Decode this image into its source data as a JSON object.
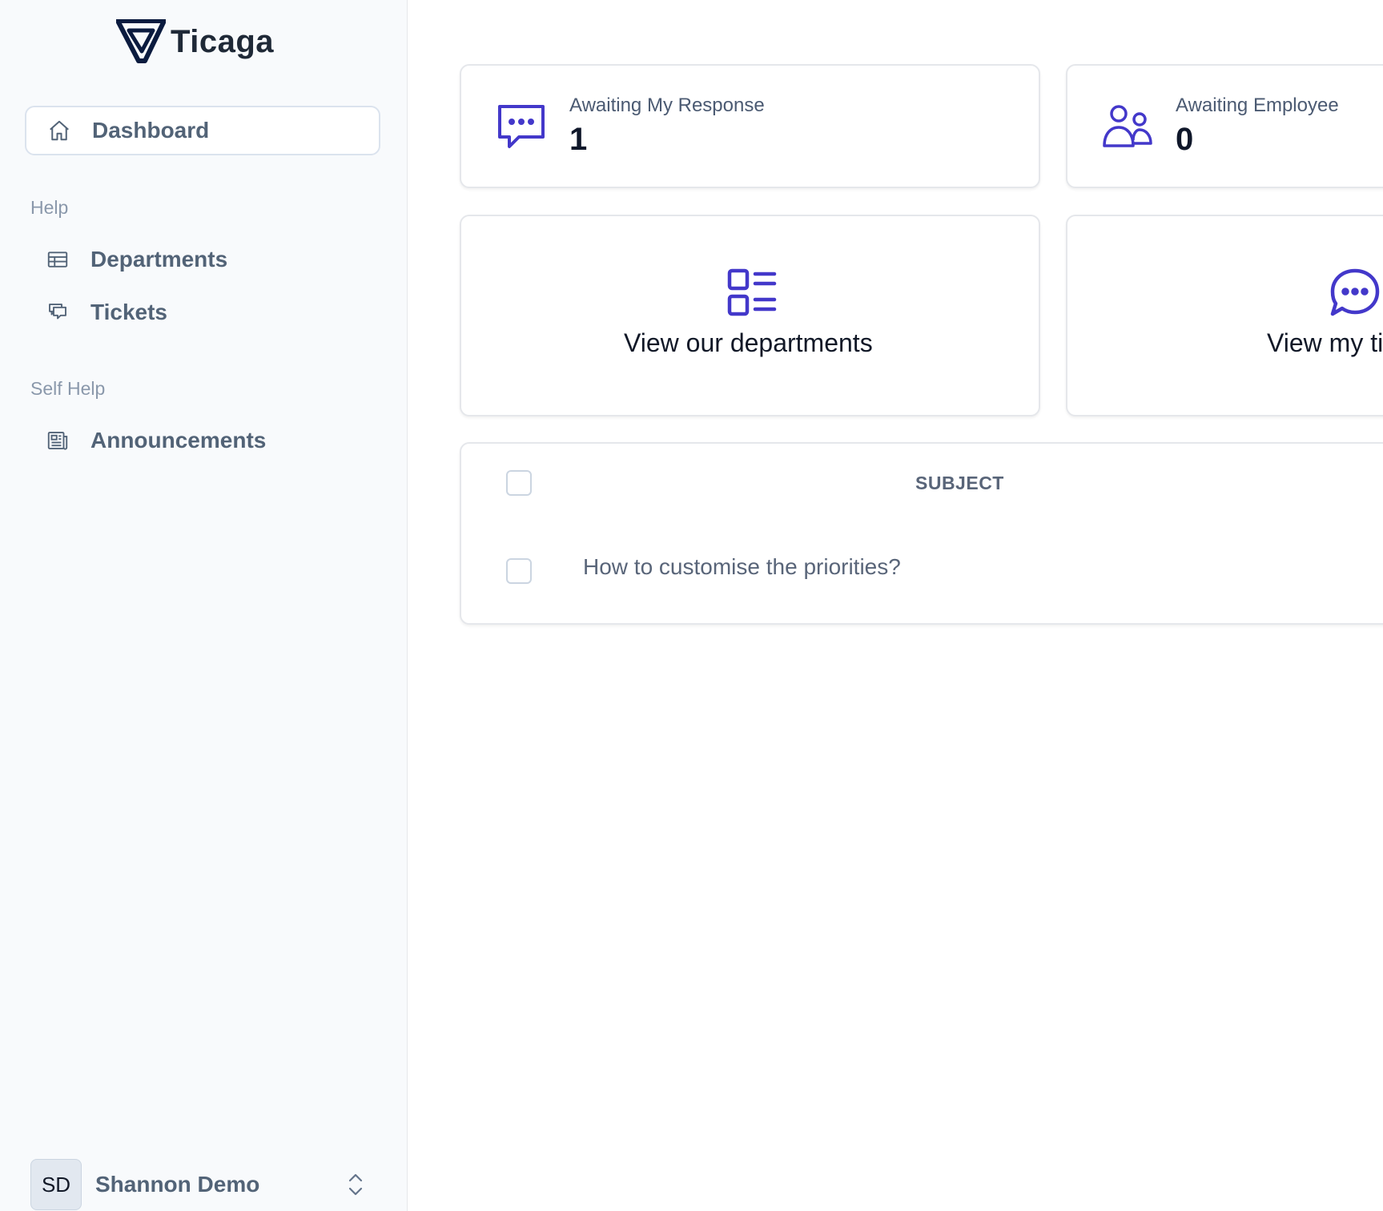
{
  "app": {
    "name": "Ticaga"
  },
  "sidebar": {
    "dashboard_label": "Dashboard",
    "sections": [
      {
        "title": "Help",
        "items": [
          {
            "label": "Departments",
            "icon": "table-icon"
          },
          {
            "label": "Tickets",
            "icon": "chat-icon"
          }
        ]
      },
      {
        "title": "Self Help",
        "items": [
          {
            "label": "Announcements",
            "icon": "newspaper-icon"
          }
        ]
      }
    ],
    "user": {
      "initials": "SD",
      "name": "Shannon Demo"
    }
  },
  "stats": [
    {
      "label": "Awaiting My Response",
      "value": "1",
      "icon": "chat-dots-icon"
    },
    {
      "label": "Awaiting Employee",
      "value": "0",
      "icon": "users-icon"
    }
  ],
  "actions": [
    {
      "label": "View our departments",
      "icon": "list-icon"
    },
    {
      "label": "View my ti",
      "icon": "chat-dots-icon"
    }
  ],
  "table": {
    "header_subject": "SUBJECT",
    "rows": [
      {
        "subject": "How to customise the priorities?"
      }
    ]
  },
  "colors": {
    "accent": "#4338ca",
    "sidebar_bg": "#f8fafc",
    "text_muted": "#526377"
  }
}
